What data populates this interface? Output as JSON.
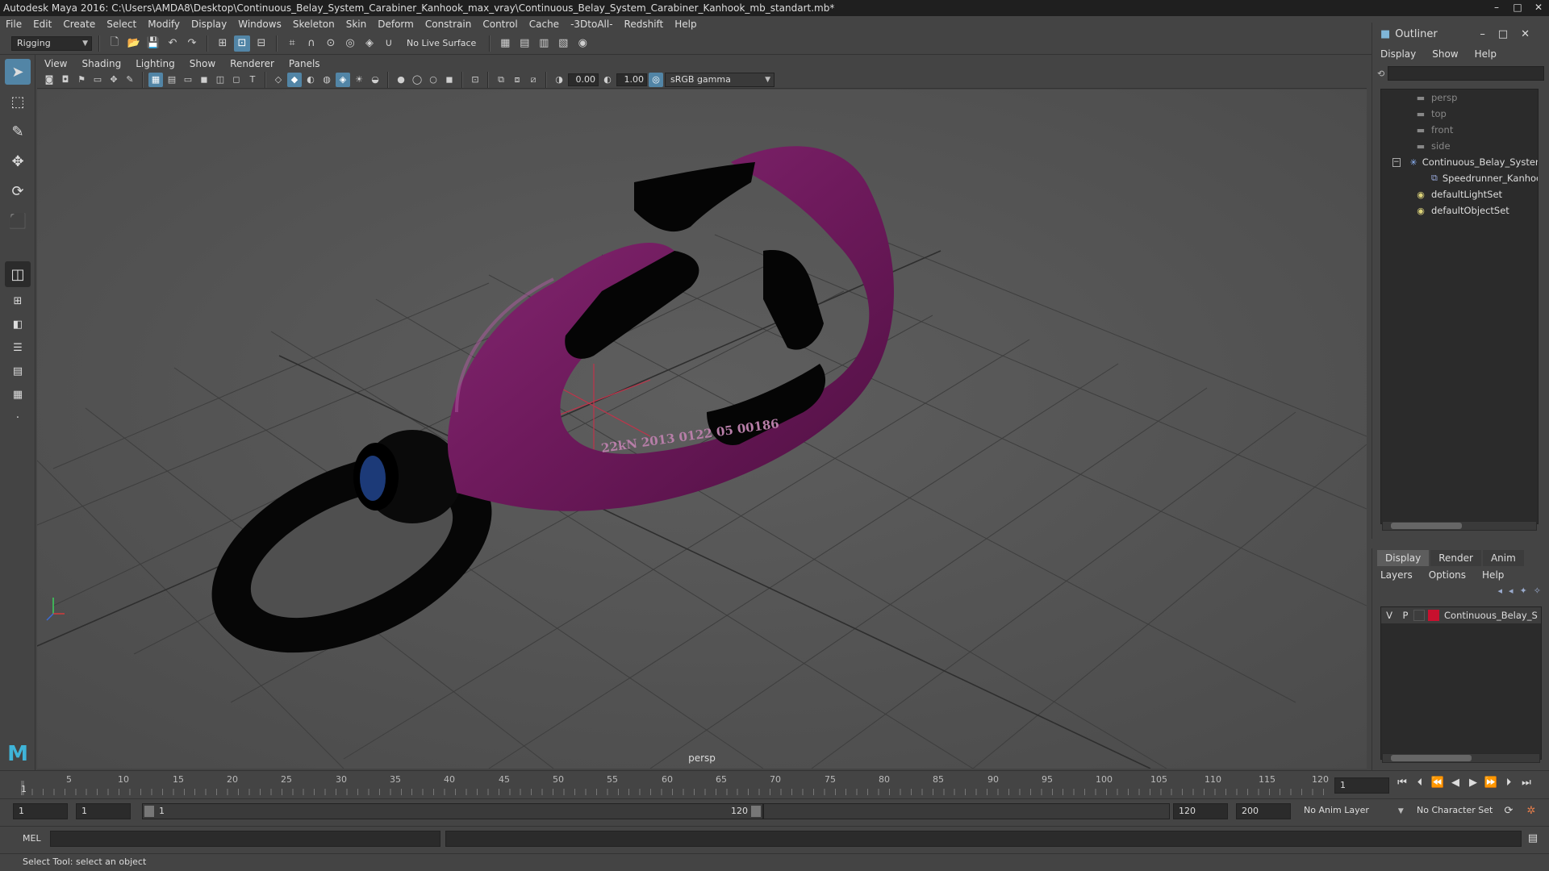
{
  "window": {
    "title": "Autodesk Maya 2016: C:\\Users\\AMDA8\\Desktop\\Continuous_Belay_System_Carabiner_Kanhook_max_vray\\Continuous_Belay_System_Carabiner_Kanhook_mb_standart.mb*",
    "minimize": "–",
    "maximize": "□",
    "close": "✕"
  },
  "menubar": {
    "items": [
      "File",
      "Edit",
      "Create",
      "Select",
      "Modify",
      "Display",
      "Windows",
      "Skeleton",
      "Skin",
      "Deform",
      "Constrain",
      "Control",
      "Cache",
      "-3DtoAll-",
      "Redshift",
      "Help"
    ]
  },
  "statusline": {
    "mode": "Rigging",
    "live_surface": "No Live Surface"
  },
  "viewport": {
    "menu": [
      "View",
      "Shading",
      "Lighting",
      "Show",
      "Renderer",
      "Panels"
    ],
    "exposure": "0.00",
    "gamma": "1.00",
    "colorspace": "sRGB gamma",
    "camera_label": "persp",
    "engraving": "22kN 2013 0122 05 00186",
    "model_color": "#6e1a5c",
    "accent_color": "#5285a6"
  },
  "outliner": {
    "title": "Outliner",
    "menu": [
      "Display",
      "Show",
      "Help"
    ],
    "items": [
      {
        "label": "persp",
        "icon": "camera-icon",
        "dim": true
      },
      {
        "label": "top",
        "icon": "camera-icon",
        "dim": true
      },
      {
        "label": "front",
        "icon": "camera-icon",
        "dim": true
      },
      {
        "label": "side",
        "icon": "camera-icon",
        "dim": true
      },
      {
        "label": "Continuous_Belay_System",
        "icon": "group-icon",
        "dim": false
      },
      {
        "label": "Speedrunner_Kanhook",
        "icon": "mesh-icon",
        "dim": false
      },
      {
        "label": "defaultLightSet",
        "icon": "set-icon",
        "dim": false
      },
      {
        "label": "defaultObjectSet",
        "icon": "set-icon",
        "dim": false
      }
    ]
  },
  "layer_editor": {
    "tabs": [
      "Display",
      "Render",
      "Anim"
    ],
    "menu": [
      "Layers",
      "Options",
      "Help"
    ],
    "layer": {
      "v": "V",
      "p": "P",
      "name": "Continuous_Belay_System",
      "color": "#c8102e"
    }
  },
  "timeline": {
    "ticks": [
      "5",
      "10",
      "15",
      "20",
      "25",
      "30",
      "35",
      "40",
      "45",
      "50",
      "55",
      "60",
      "65",
      "70",
      "75",
      "80",
      "85",
      "90",
      "95",
      "100",
      "105",
      "110",
      "115",
      "120"
    ],
    "current_frame_marker": "1",
    "current_frame": "1"
  },
  "range": {
    "start": "1",
    "playback_start": "1",
    "slider_start": "1",
    "slider_end": "120",
    "playback_end": "120",
    "end": "200",
    "anim_layer": "No Anim Layer",
    "character_set": "No Character Set"
  },
  "cmdline": {
    "label": "MEL"
  },
  "helpline": {
    "text": "Select Tool: select an object"
  }
}
